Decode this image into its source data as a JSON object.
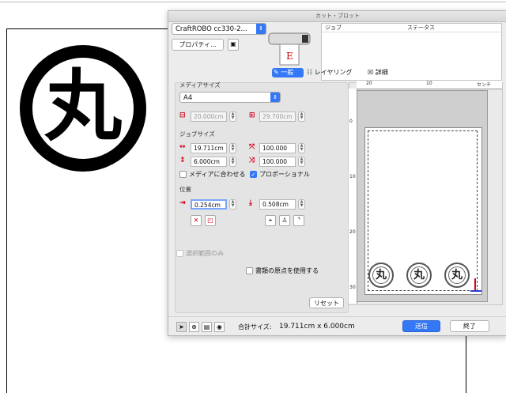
{
  "dialog": {
    "title": "カット・プロット",
    "device_select": "CraftROBO cc330-2...",
    "properties_button": "プロパティ...",
    "status_table": {
      "columns": [
        "ジョブ",
        "ステータス"
      ]
    },
    "tabs": [
      {
        "label": "一般",
        "active": true,
        "icon": "general-icon"
      },
      {
        "label": "レイヤリング",
        "active": false,
        "icon": "layering-icon"
      },
      {
        "label": "詳細",
        "active": false,
        "icon": "detail-icon"
      }
    ],
    "media_size": {
      "section": "メディアサイズ",
      "value": "A4",
      "width": "20.000cm",
      "height": "29.700cm"
    },
    "job_size": {
      "section": "ジョブサイズ",
      "width": "19.711cm",
      "height": "6.000cm",
      "scale_x": "100.000",
      "scale_y": "100.000",
      "fit_media_label": "メディアに合わせる",
      "fit_media_checked": false,
      "proportional_label": "プロポーショナル",
      "proportional_checked": true
    },
    "position": {
      "section": "位置",
      "x": "0.254cm",
      "y": "0.508cm"
    },
    "selection_only_label": "選択範囲のみ",
    "use_origin_label": "書類の原点を使用する",
    "reset_button": "リセット",
    "ruler": {
      "unit": "センチ",
      "top_ticks": [
        "20",
        "10"
      ],
      "left_ticks": [
        "0",
        "10",
        "20",
        "30"
      ]
    },
    "total_size_label": "合計サイズ:",
    "total_size_value": "19.711cm x 6.000cm",
    "send_button": "送信",
    "close_button": "終了",
    "accent_color": "#3478f6"
  },
  "document": {
    "logo_glyph": "丸"
  }
}
